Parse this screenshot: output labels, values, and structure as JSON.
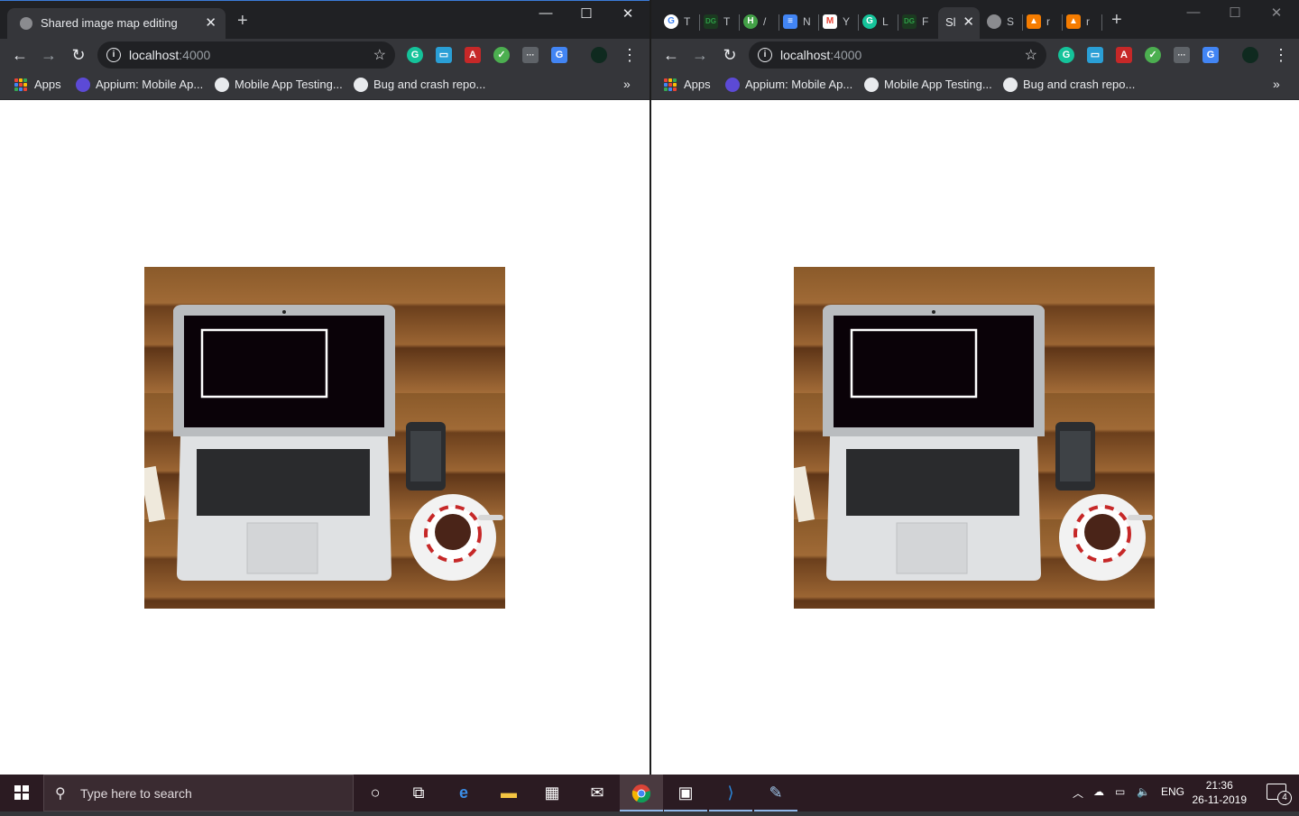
{
  "left_window": {
    "tab_title": "Shared image map editing",
    "tab_close": "✕",
    "new_tab": "+",
    "controls": {
      "minimize": "—",
      "maximize": "☐",
      "close": "✕"
    },
    "url_host": "localhost",
    "url_port": ":4000",
    "bookmarks": {
      "apps": "Apps",
      "items": [
        "Appium: Mobile Ap...",
        "Mobile App Testing...",
        "Bug and crash repo..."
      ],
      "more": "»"
    }
  },
  "right_window": {
    "tabs": [
      {
        "letter": "T",
        "icon": "google-icon",
        "color": "#ffffff"
      },
      {
        "letter": "T",
        "icon": "dg-icon",
        "color": "#2e7d32"
      },
      {
        "letter": "/",
        "icon": "h-icon",
        "color": "#43a047"
      },
      {
        "letter": "N",
        "icon": "docs-icon",
        "color": "#4285f4"
      },
      {
        "letter": "Y",
        "icon": "gmail-icon",
        "color": "#ea4335"
      },
      {
        "letter": "L",
        "icon": "grammarly-icon",
        "color": "#15c39a"
      },
      {
        "letter": "F",
        "icon": "dg-icon",
        "color": "#2e7d32"
      }
    ],
    "active_tab_title": "Sl",
    "after_tabs": [
      {
        "letter": "S",
        "icon": "globe-icon",
        "color": "#8a8b8f"
      },
      {
        "letter": "r",
        "icon": "figma-icon",
        "color": "#f57c00"
      },
      {
        "letter": "r",
        "icon": "figma-icon",
        "color": "#f57c00"
      }
    ],
    "tab_close": "✕",
    "new_tab": "+",
    "controls": {
      "minimize": "—",
      "maximize": "☐",
      "close": "✕"
    },
    "url_host": "localhost",
    "url_port": ":4000",
    "bookmarks": {
      "apps": "Apps",
      "items": [
        "Appium: Mobile Ap...",
        "Mobile App Testing...",
        "Bug and crash repo..."
      ],
      "more": "»"
    }
  },
  "extensions": [
    {
      "icon": "grammarly-icon",
      "color": "#15c39a",
      "glyph": "G"
    },
    {
      "icon": "screenshot-icon",
      "color": "#2a9fd6",
      "glyph": "▭"
    },
    {
      "icon": "pdf-icon",
      "color": "#c62828",
      "glyph": "A"
    },
    {
      "icon": "check-icon",
      "color": "#4caf50",
      "glyph": "✓"
    },
    {
      "icon": "dots-icon",
      "color": "#5f6368",
      "glyph": "···"
    },
    {
      "icon": "translate-icon",
      "color": "#4285f4",
      "glyph": "G"
    },
    {
      "icon": "profile-icon",
      "color": "#0f2a1f",
      "glyph": ""
    }
  ],
  "taskbar": {
    "search_placeholder": "Type here to search",
    "language": "ENG",
    "time": "21:36",
    "date": "26-11-2019",
    "notification_count": "4"
  },
  "colors": {
    "chrome_dark": "#202124",
    "toolbar": "#35363a",
    "taskbar": "#2b1b22"
  }
}
